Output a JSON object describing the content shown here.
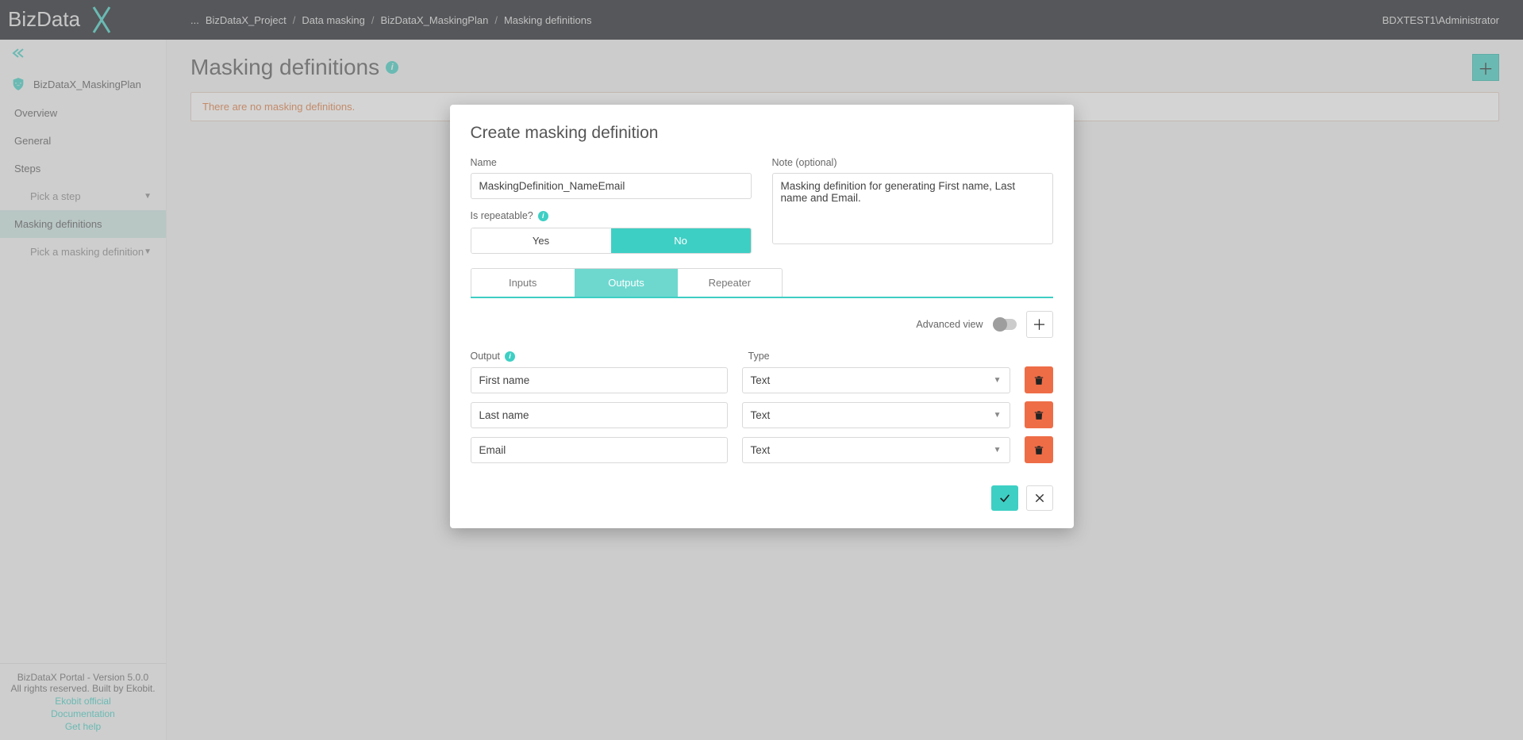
{
  "header": {
    "logo_text": "BizDataX",
    "breadcrumb": [
      "...",
      "BizDataX_Project",
      "Data masking",
      "BizDataX_MaskingPlan",
      "Masking definitions"
    ],
    "user": "BDXTEST1\\Administrator"
  },
  "sidebar": {
    "plan_name": "BizDataX_MaskingPlan",
    "items": {
      "overview": "Overview",
      "general": "General",
      "steps": "Steps",
      "pick_step": "Pick a step",
      "masking_defs": "Masking definitions",
      "pick_masking": "Pick a masking definition"
    },
    "footer": {
      "line1": "BizDataX Portal - Version 5.0.0",
      "line2": "All rights reserved. Built by Ekobit.",
      "link1": "Ekobit official",
      "link2": "Documentation",
      "link3": "Get help"
    }
  },
  "page": {
    "title": "Masking definitions",
    "empty_msg": "There are no masking definitions."
  },
  "modal": {
    "title": "Create masking definition",
    "name_label": "Name",
    "name_value": "MaskingDefinition_NameEmail",
    "note_label": "Note (optional)",
    "note_value": "Masking definition for generating First name, Last name and Email.",
    "repeatable_label": "Is repeatable?",
    "yes": "Yes",
    "no": "No",
    "tabs": {
      "inputs": "Inputs",
      "outputs": "Outputs",
      "repeater": "Repeater"
    },
    "advanced_label": "Advanced view",
    "output_label": "Output",
    "type_label": "Type",
    "outputs": [
      {
        "name": "First name",
        "type": "Text"
      },
      {
        "name": "Last name",
        "type": "Text"
      },
      {
        "name": "Email",
        "type": "Text"
      }
    ]
  }
}
